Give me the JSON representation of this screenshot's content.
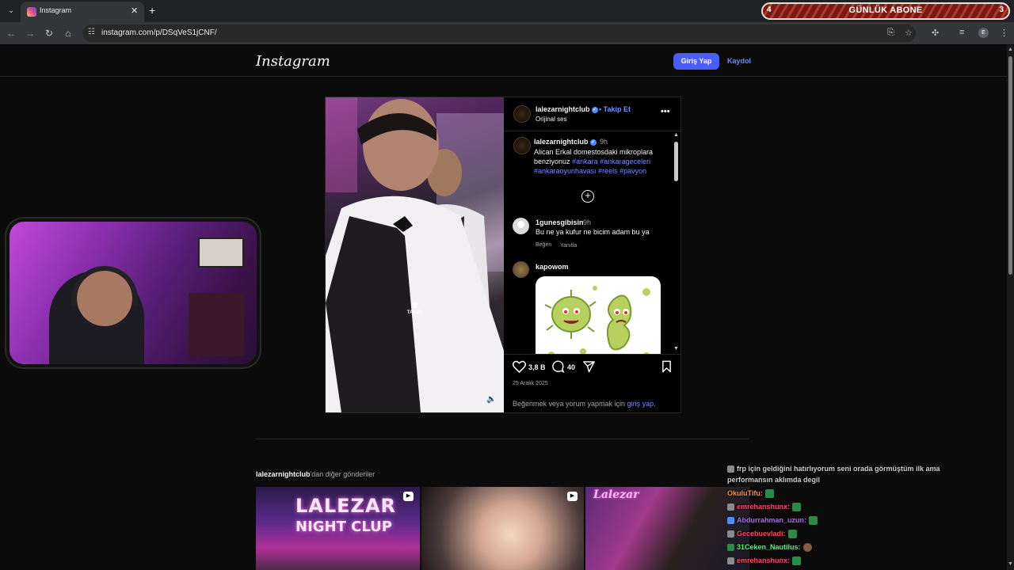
{
  "browser": {
    "tab_title": "Instagram",
    "url": "instagram.com/p/DSqVeS1jCNF/",
    "profile_initial": "E"
  },
  "overlay": {
    "abone_left": "4",
    "abone_title": "GÜNLÜK ABONE",
    "abone_right": "3"
  },
  "ig": {
    "logo": "Instagram",
    "login_button": "Giriş Yap",
    "signup_link": "Kaydol",
    "post": {
      "username": "lalezarnightclub",
      "follow": "• Takip Et",
      "audio": "Orijinal ses",
      "caption": {
        "username": "lalezarnightclub",
        "time": "9h",
        "text": "Alican Erkal domestosdaki mikroplara benziyonuz",
        "hashtags": "#ankara #ankarageceleri #ankaraoyunhavası #reels #pavyon"
      },
      "watermark": "TANER",
      "comments": [
        {
          "username": "1gunesgibisin",
          "time": "9h",
          "text": "Bu ne ya kufur ne bicim adam bu ya",
          "like": "Beğen",
          "reply": "Yanıtla"
        },
        {
          "username": "kapowom"
        }
      ],
      "likes": "3,8 B",
      "comment_count": "40",
      "date": "25 Aralık 2025",
      "login_prompt": "Beğenmek veya yorum yapmak için",
      "login_prompt_link": "giriş yap",
      "login_prompt_end": "."
    },
    "more_posts": {
      "user": "lalezarnightclub",
      "suffix": "'dan diğer gönderiler",
      "thumb1_line1": "LALEZAR",
      "thumb1_line2": "NIGHT CLUP",
      "thumb3_logo": "Lalezar"
    }
  },
  "chat": [
    {
      "user": "",
      "text": "frp için geldiğini hatırlıyorum seni orada görmüştüm ilk ama",
      "color": "#cfcfcf"
    },
    {
      "user": "",
      "text": "performansın aklımda degil",
      "color": "#cfcfcf"
    },
    {
      "user": "OkuluTifu:",
      "text": "",
      "color": "#ff9a3a"
    },
    {
      "user": "emrehanshunx:",
      "text": "",
      "color": "#ff4a6a"
    },
    {
      "user": "Abdurrahman_uzun:",
      "text": "",
      "color": "#b06aff"
    },
    {
      "user": "Gecebuevladi:",
      "text": "",
      "color": "#ff4a6a"
    },
    {
      "user": "31Ceken_Nautilus:",
      "text": "",
      "color": "#4aff6a"
    },
    {
      "user": "emrehanshunx:",
      "text": "",
      "color": "#ff4a6a"
    }
  ]
}
